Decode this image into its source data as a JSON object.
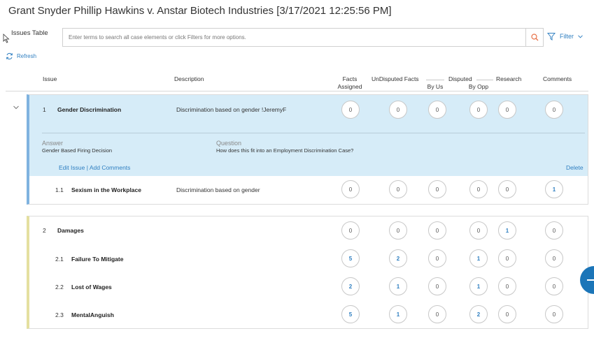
{
  "title": "Grant Snyder Phillip Hawkins v. Anstar Biotech Industries [3/17/2021 12:25:56 PM]",
  "issues_label": "Issues Table",
  "search": {
    "placeholder": "Enter terms to search all case elements or click Filters for more options."
  },
  "filter_label": "Filter",
  "refresh_label": "Refresh",
  "columns": {
    "issue": "Issue",
    "description": "Description",
    "facts_assigned_1": "Facts",
    "facts_assigned_2": "Assigned",
    "undisputed": "UnDisputed Facts",
    "disputed": "Disputed",
    "by_us": "By Us",
    "by_opp": "By Opp",
    "research": "Research",
    "comments": "Comments"
  },
  "issue1": {
    "number": "1",
    "name": "Gender Discrimination",
    "description": "Discrimination based on gender !JeremyF",
    "counts": [
      "0",
      "0",
      "0",
      "0",
      "0",
      "0"
    ],
    "answer_label": "Answer",
    "answer_value": "Gender Based Firing Decision",
    "question_label": "Question",
    "question_value": "How does this fit into an Employment Discrimination Case?",
    "edit_link": "Edit Issue",
    "link_sep": "|",
    "add_comments_link": "Add Comments",
    "delete_link": "Delete",
    "sub": [
      {
        "number": "1.1",
        "name": "Sexism in the Workplace",
        "description": "Discrimination based on gender",
        "counts": [
          "0",
          "0",
          "0",
          "0",
          "0",
          "1"
        ]
      }
    ]
  },
  "issue2": {
    "number": "2",
    "name": "Damages",
    "counts": [
      "0",
      "0",
      "0",
      "0",
      "1",
      "0"
    ],
    "sub": [
      {
        "number": "2.1",
        "name": "Failure To Mitigate",
        "counts": [
          "5",
          "2",
          "0",
          "1",
          "0",
          "0"
        ]
      },
      {
        "number": "2.2",
        "name": "Lost of Wages",
        "counts": [
          "2",
          "1",
          "0",
          "1",
          "0",
          "0"
        ]
      },
      {
        "number": "2.3",
        "name": "MentalAnguish",
        "counts": [
          "5",
          "1",
          "0",
          "2",
          "0",
          "0"
        ]
      }
    ]
  }
}
